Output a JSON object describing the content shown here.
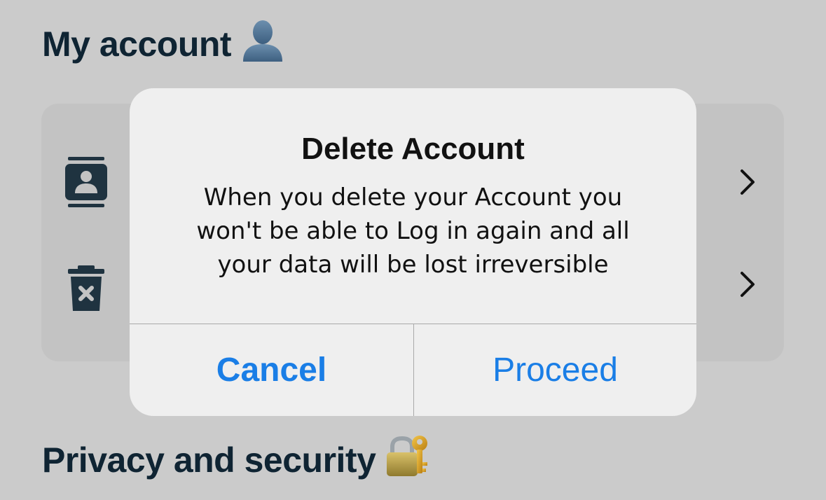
{
  "sections": {
    "account_title": "My account",
    "account_emoji": "bust-in-silhouette-icon",
    "privacy_title": "Privacy and security",
    "privacy_emoji": "lock-with-key-icon"
  },
  "rows": [
    {
      "icon": "contact-card-icon"
    },
    {
      "icon": "trash-icon"
    }
  ],
  "dialog": {
    "title": "Delete Account",
    "message": "When you delete your Account you won't be able to Log in again and all your data will be lost irreversible",
    "cancel_label": "Cancel",
    "proceed_label": "Proceed"
  },
  "colors": {
    "background": "#cbcbcb",
    "heading": "#0f2433",
    "dialog_bg": "#efefef",
    "button_accent": "#1a7ee6",
    "icon": "#1f3340"
  }
}
